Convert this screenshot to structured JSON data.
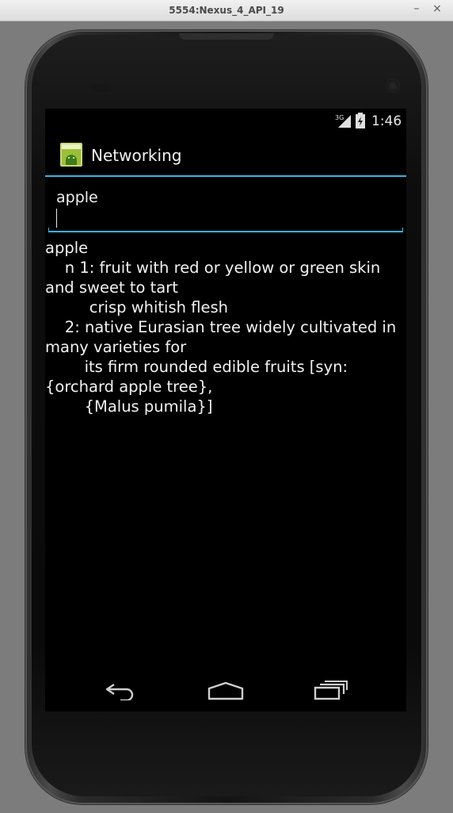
{
  "window": {
    "title": "5554:Nexus_4_API_19",
    "minimize_glyph": "–",
    "close_glyph": "×"
  },
  "status_bar": {
    "network_label": "3G",
    "time": "1:46"
  },
  "action_bar": {
    "app_icon": "android-launcher-icon",
    "title": "Networking"
  },
  "search": {
    "value": "apple"
  },
  "result": {
    "text": "apple\n    n 1: fruit with red or yellow or green skin and sweet to tart\n         crisp whitish flesh\n    2: native Eurasian tree widely cultivated in many varieties for\n        its firm rounded edible fruits [syn: {orchard apple tree},\n        {Malus pumila}]"
  },
  "nav_bar": {
    "back_icon": "back-icon",
    "home_icon": "home-icon",
    "recents_icon": "recent-apps-icon"
  },
  "colors": {
    "accent": "#33b5e5",
    "screen_bg": "#000000",
    "text": "#f2f2f2"
  }
}
